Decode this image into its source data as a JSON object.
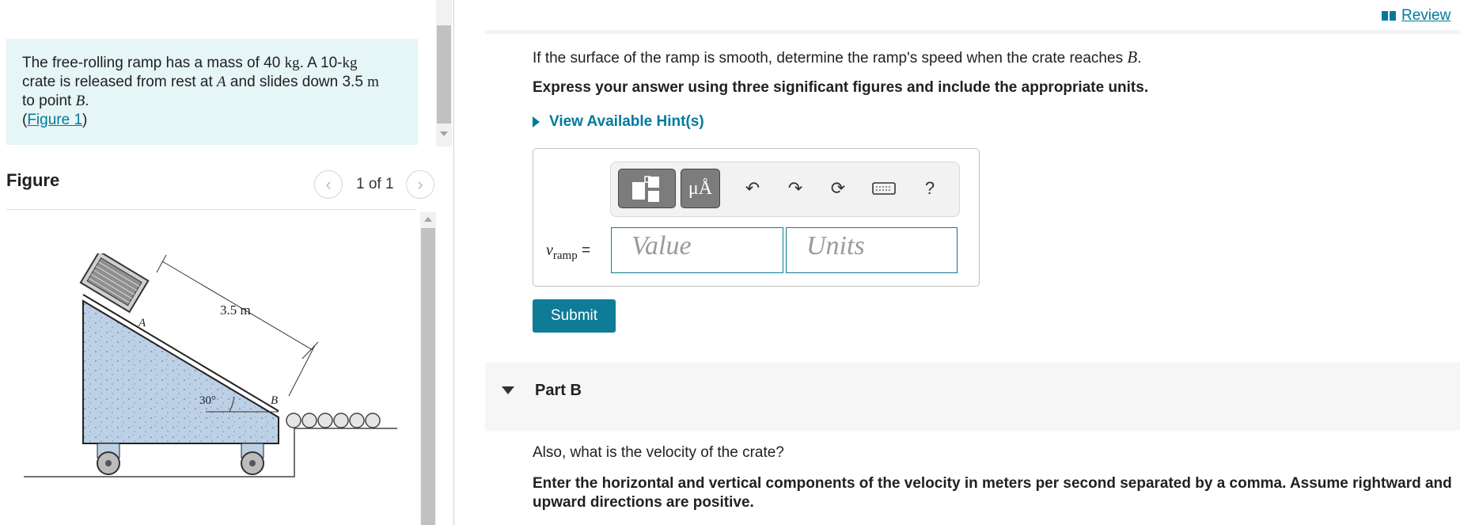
{
  "problem": {
    "line1_pre": "The free-rolling ramp has a mass of 40 ",
    "line1_unit": "kg",
    "line1_post": ". A 10-",
    "line1_unit2": "kg",
    "line2_pre": "crate is released from rest at ",
    "line2_pointA": "A",
    "line2_post": " and slides down 3.5 ",
    "line2_unit": "m",
    "line3_pre": "to point ",
    "line3_pointB": "B",
    "line3_post": ".",
    "figure_paren_open": "(",
    "figure_link": "Figure 1",
    "figure_paren_close": ")"
  },
  "figure_panel": {
    "title": "Figure",
    "counter": "1 of 1",
    "prev_icon": "chevron-left-icon",
    "next_icon": "chevron-right-icon",
    "labels": {
      "distance": "3.5 m",
      "point_a": "A",
      "point_b": "B",
      "angle": "30°"
    }
  },
  "header": {
    "review_label": "Review",
    "review_icon": "book-icon"
  },
  "part_a": {
    "question_pre": "If the surface of the ramp is smooth, determine the ramp's speed when the crate reaches ",
    "question_point": "B",
    "question_post": ".",
    "instruction": "Express your answer using three significant figures and include the appropriate units.",
    "hints_label": "View Available Hint(s)",
    "variable": "v",
    "variable_sub": "ramp",
    "equals": "=",
    "value_placeholder": "Value",
    "units_placeholder": "Units",
    "submit_label": "Submit",
    "toolbar": {
      "templates_icon": "templates-icon",
      "units_symbol": "μÅ",
      "undo_icon": "undo-icon",
      "redo_icon": "redo-icon",
      "reset_icon": "reset-icon",
      "keyboard_icon": "keyboard-icon",
      "help_symbol": "?"
    }
  },
  "part_b": {
    "title": "Part B",
    "question": "Also, what is the velocity of the crate?",
    "instruction": "Enter the horizontal and vertical components of the velocity in meters per second separated by a comma. Assume rightward and upward directions are positive."
  },
  "colors": {
    "accent": "#0e7c97",
    "link": "#007a9c",
    "problem_bg": "#e6f5f6",
    "ramp_fill": "#bcd0e6"
  }
}
